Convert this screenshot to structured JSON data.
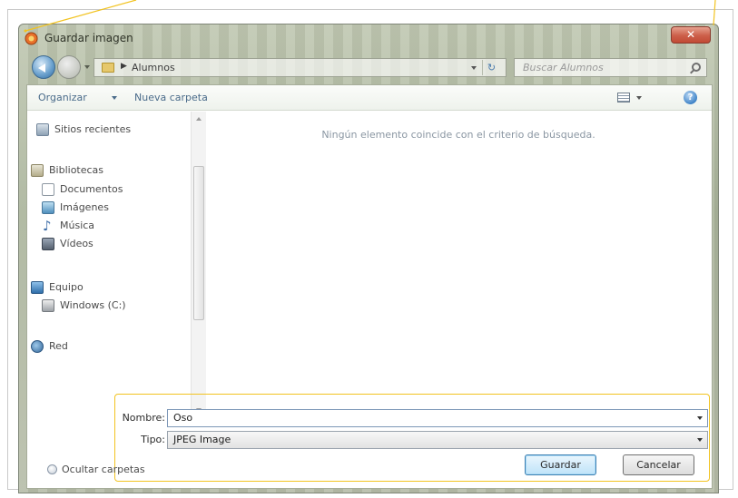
{
  "window": {
    "title": "Guardar imagen",
    "close_label": "✕"
  },
  "navigation": {
    "address_folder": "Alumnos",
    "search_placeholder": "Buscar Alumnos"
  },
  "toolbar": {
    "organize_label": "Organizar",
    "new_folder_label": "Nueva carpeta"
  },
  "sidebar": {
    "items": [
      {
        "label": "Sitios recientes",
        "icon": "recent-places-icon"
      },
      {
        "label": "Bibliotecas",
        "icon": "libraries-icon"
      },
      {
        "label": "Documentos",
        "icon": "documents-icon"
      },
      {
        "label": "Imágenes",
        "icon": "pictures-icon"
      },
      {
        "label": "Música",
        "icon": "music-icon"
      },
      {
        "label": "Vídeos",
        "icon": "videos-icon"
      },
      {
        "label": "Equipo",
        "icon": "computer-icon"
      },
      {
        "label": "Windows (C:)",
        "icon": "drive-icon"
      },
      {
        "label": "Red",
        "icon": "network-icon"
      }
    ]
  },
  "content": {
    "empty_message": "Ningún elemento coincide con el criterio de búsqueda."
  },
  "form": {
    "name_label": "Nombre:",
    "name_value": "Oso",
    "type_label": "Tipo:",
    "type_value": "JPEG Image"
  },
  "footer": {
    "hide_folders_label": "Ocultar carpetas",
    "save_label": "Guardar",
    "cancel_label": "Cancelar"
  },
  "colors": {
    "highlight": "#f2c320",
    "link_text": "#4a6b8a"
  }
}
